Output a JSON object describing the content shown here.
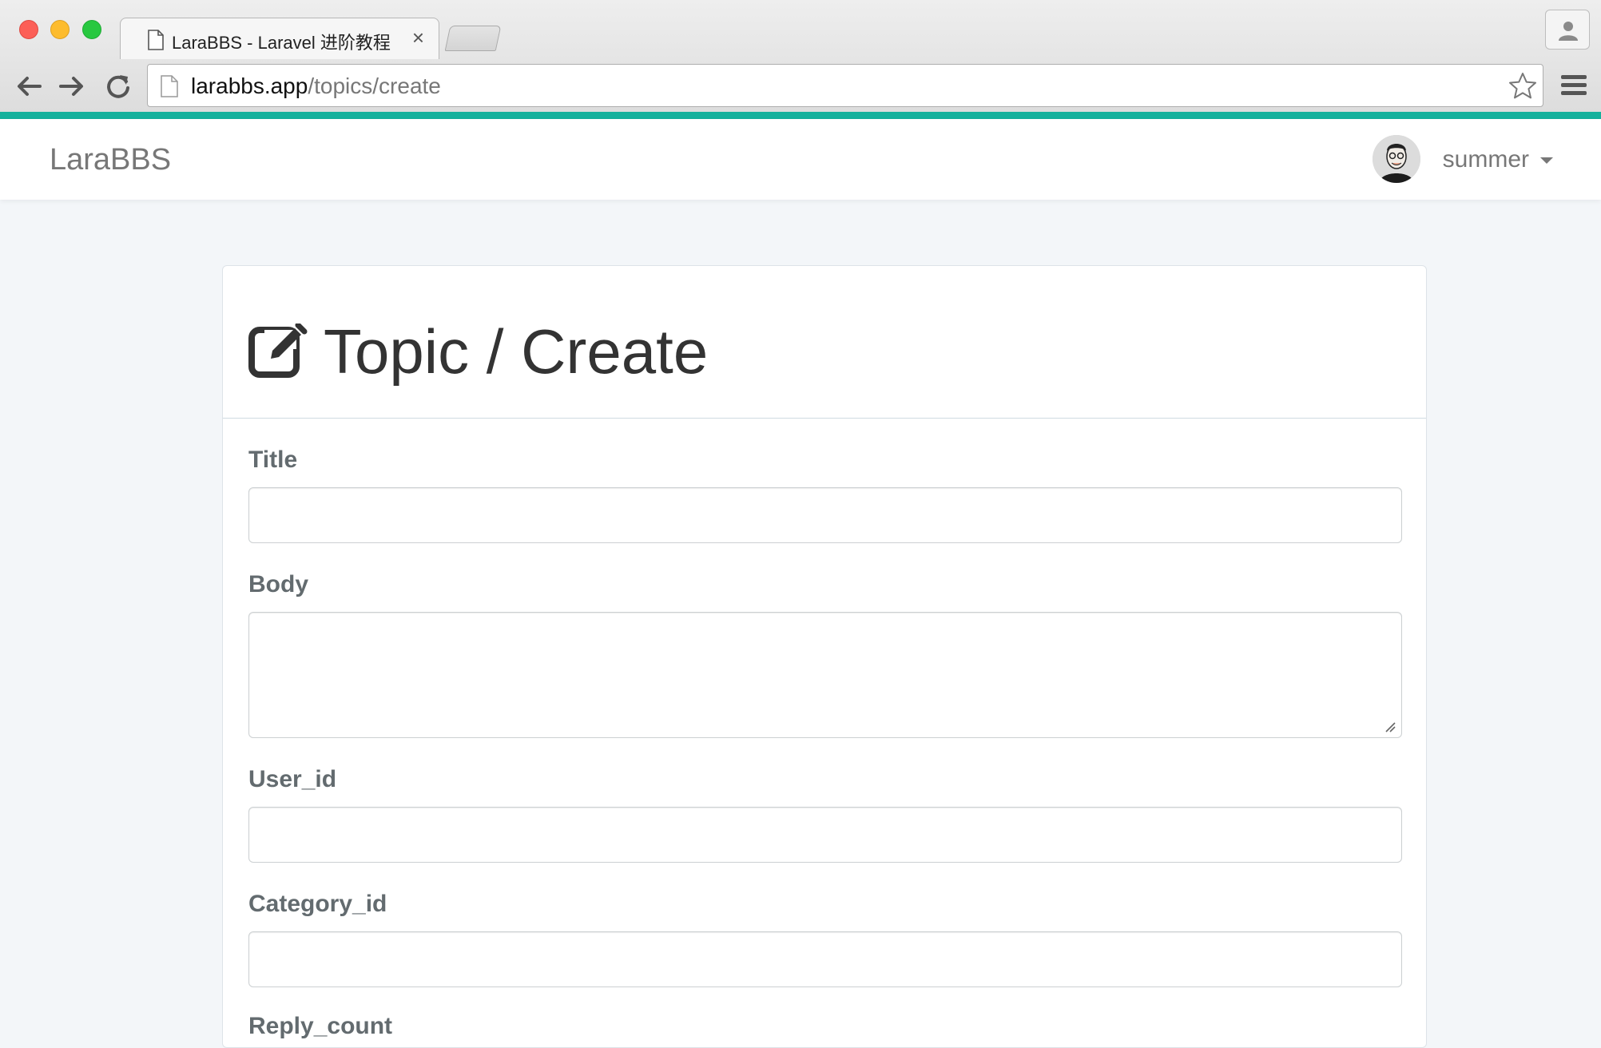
{
  "browser": {
    "tab_title": "LaraBBS - Laravel 进阶教程",
    "tab_close": "×",
    "url_host": "larabbs.app",
    "url_path": "/topics/create"
  },
  "navbar": {
    "brand": "LaraBBS",
    "username": "summer",
    "accent_color": "#14b19c"
  },
  "page": {
    "title": "Topic / Create",
    "title_icon": "edit-icon"
  },
  "form": {
    "fields": [
      {
        "label": "Title",
        "type": "text",
        "value": ""
      },
      {
        "label": "Body",
        "type": "textarea",
        "value": ""
      },
      {
        "label": "User_id",
        "type": "text",
        "value": ""
      },
      {
        "label": "Category_id",
        "type": "text",
        "value": ""
      },
      {
        "label": "Reply_count",
        "type": "text",
        "value": ""
      }
    ]
  }
}
